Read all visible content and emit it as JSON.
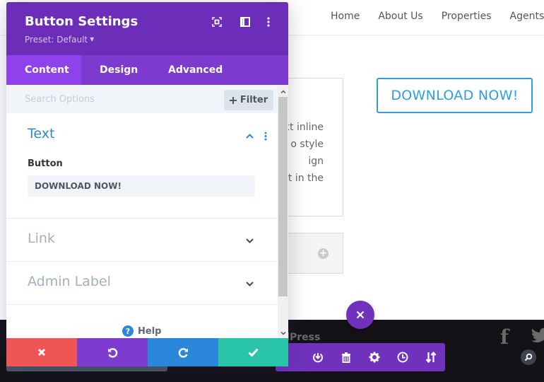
{
  "site": {
    "nav": [
      "Home",
      "About Us",
      "Properties",
      "Agents"
    ],
    "body_text_lines": [
      "xt inline",
      "o style",
      "ign",
      "t in the"
    ],
    "cta_button_label": "DOWNLOAD NOW!",
    "footer_text": "dPress",
    "colors": {
      "cta": "#2e9ee0",
      "footer_bg": "#141216"
    }
  },
  "modal": {
    "title": "Button Settings",
    "preset_label": "Preset: Default",
    "header_icons": [
      "fullscreen-icon",
      "split-view-icon",
      "more-options-icon"
    ],
    "tabs": [
      {
        "label": "Content",
        "active": true
      },
      {
        "label": "Design",
        "active": false
      },
      {
        "label": "Advanced",
        "active": false
      }
    ],
    "search": {
      "placeholder": "Search Options",
      "value": ""
    },
    "filter_label": "Filter",
    "sections": [
      {
        "title": "Text",
        "expanded": true,
        "fields": [
          {
            "label": "Button",
            "value": "DOWNLOAD NOW!"
          }
        ]
      },
      {
        "title": "Link",
        "expanded": false
      },
      {
        "title": "Admin Label",
        "expanded": false
      }
    ],
    "help_label": "Help",
    "actions": [
      "cancel",
      "undo",
      "redo",
      "save"
    ],
    "colors": {
      "header": "#6c2eb9",
      "tabs": "#7d3ace",
      "active_tab": "#8f42ec",
      "cancel": "#ef5555",
      "undo": "#7e3bd0",
      "redo": "#2b87da",
      "save": "#29c4a9",
      "open_section": "#2b87da"
    }
  },
  "page_toolbar": {
    "buttons": [
      "add-icon",
      "portability-icon",
      "trash-icon",
      "settings-icon",
      "history-icon",
      "sort-icon"
    ]
  }
}
